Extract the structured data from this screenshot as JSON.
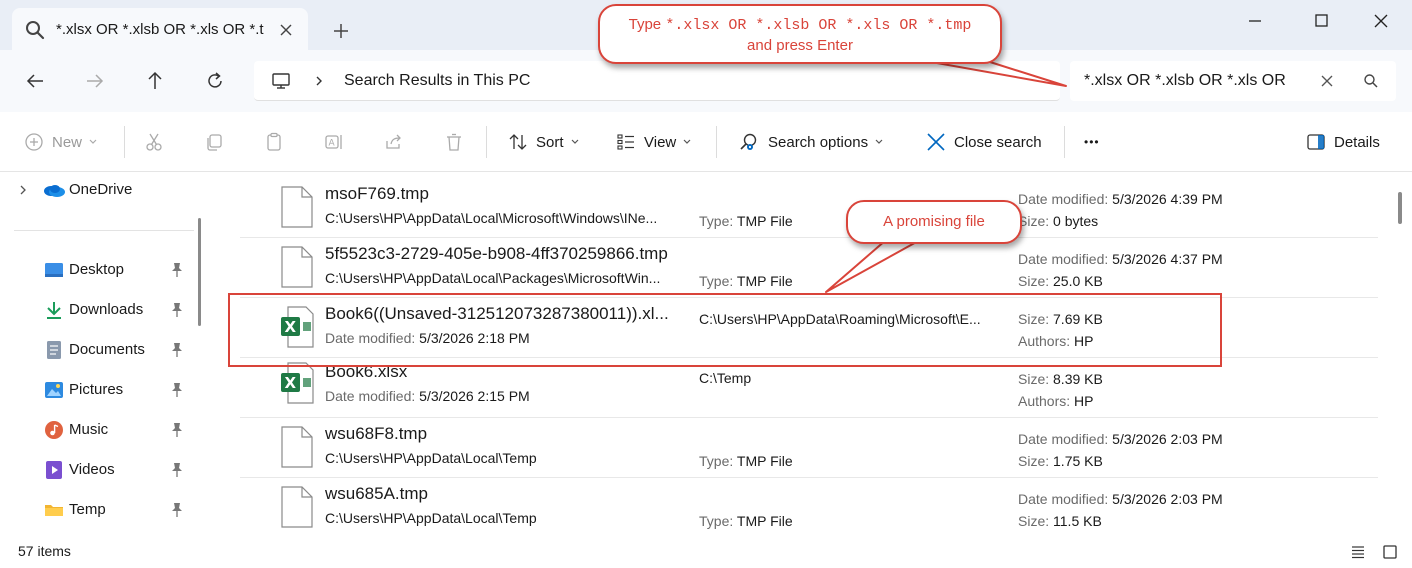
{
  "tab": {
    "title": "*.xlsx OR *.xlsb OR *.xls OR *.t"
  },
  "address": {
    "path": "Search Results in This PC"
  },
  "search": {
    "value": "*.xlsx OR *.xlsb OR *.xls OR"
  },
  "toolbar": {
    "new": "New",
    "sort": "Sort",
    "view": "View",
    "search_options": "Search options",
    "close_search": "Close search",
    "more": "•••",
    "details": "Details"
  },
  "sidebar": {
    "onedrive": "OneDrive",
    "items": [
      {
        "label": "Desktop"
      },
      {
        "label": "Downloads"
      },
      {
        "label": "Documents"
      },
      {
        "label": "Pictures"
      },
      {
        "label": "Music"
      },
      {
        "label": "Videos"
      },
      {
        "label": "Temp"
      }
    ]
  },
  "files": [
    {
      "name": "msoF769.tmp",
      "path": "C:\\Users\\HP\\AppData\\Local\\Microsoft\\Windows\\INe...",
      "type_label": "Type:",
      "type": "TMP File",
      "date_label": "Date modified:",
      "date": "5/3/2026 4:39 PM",
      "size_label": "Size:",
      "size": "0 bytes"
    },
    {
      "name": "5f5523c3-2729-405e-b908-4ff370259866.tmp",
      "path": "C:\\Users\\HP\\AppData\\Local\\Packages\\MicrosoftWin...",
      "type_label": "Type:",
      "type": "TMP File",
      "date_label": "Date modified:",
      "date": "5/3/2026 4:37 PM",
      "size_label": "Size:",
      "size": "25.0 KB"
    },
    {
      "name": "Book6((Unsaved-312512073287380011)).xl...",
      "date_label": "Date modified:",
      "date": "5/3/2026 2:18 PM",
      "path": "C:\\Users\\HP\\AppData\\Roaming\\Microsoft\\E...",
      "size_label": "Size:",
      "size": "7.69 KB",
      "authors_label": "Authors:",
      "authors": "HP"
    },
    {
      "name": "Book6.xlsx",
      "date_label": "Date modified:",
      "date": "5/3/2026 2:15 PM",
      "path": "C:\\Temp",
      "size_label": "Size:",
      "size": "8.39 KB",
      "authors_label": "Authors:",
      "authors": "HP"
    },
    {
      "name": "wsu68F8.tmp",
      "path": "C:\\Users\\HP\\AppData\\Local\\Temp",
      "type_label": "Type:",
      "type": "TMP File",
      "date_label": "Date modified:",
      "date": "5/3/2026 2:03 PM",
      "size_label": "Size:",
      "size": "1.75 KB"
    },
    {
      "name": "wsu685A.tmp",
      "path": "C:\\Users\\HP\\AppData\\Local\\Temp",
      "type_label": "Type:",
      "type": "TMP File",
      "date_label": "Date modified:",
      "date": "5/3/2026 2:03 PM",
      "size_label": "Size:",
      "size": "11.5 KB"
    }
  ],
  "status": {
    "count": "57 items"
  },
  "annotations": {
    "callout1_prefix": "Type ",
    "callout1_code": "*.xlsx OR *.xlsb OR *.xls OR *.tmp",
    "callout1_line2": "and press Enter",
    "callout2": "A promising file",
    "color": "#d9443a"
  },
  "colors": {
    "excel_green": "#1f7a45",
    "accent_blue": "#0067c0"
  }
}
